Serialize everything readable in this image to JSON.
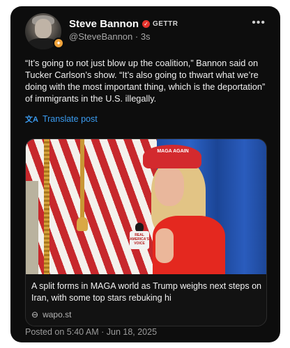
{
  "post": {
    "author_name": "Steve Bannon",
    "platform": "GETTR",
    "meta": "@SteveBannon · 3s",
    "more_icon": "more-dots-icon",
    "body": "“It’s going to not just blow up the coalition,” Bannon said on Tucker Carlson’s show. “It’s also going to thwart what we’re doing with the most important thing, which is the deportation” of immigrants in the U.S. illegally.",
    "translate_label": "Translate post",
    "posted": "Posted on 5:40 AM · Jun 18, 2025"
  },
  "link_card": {
    "title": "A split forms in MAGA world as Trump weighs next steps on Iran, with some top stars rebuking hi",
    "domain": "wapo.st",
    "image_hat_text": "MAGA AGAIN",
    "image_mic_text": "REAL AMERICA'S VOICE"
  },
  "colors": {
    "background": "#0d0d0d",
    "accent_link": "#3a9bef",
    "verified": "#e5322b",
    "badge": "#f0a33a"
  }
}
